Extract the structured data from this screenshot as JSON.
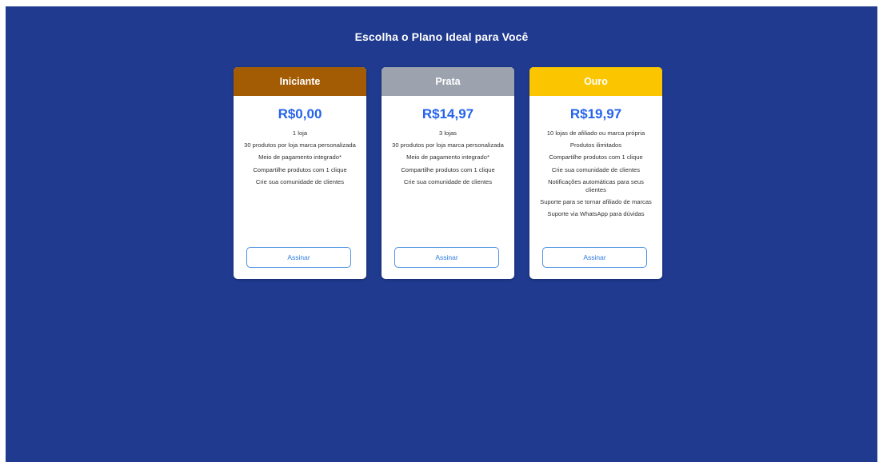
{
  "page": {
    "title": "Escolha o Plano Ideal para Você"
  },
  "colors": {
    "background": "#1f3a8f",
    "price": "#2563eb",
    "button_border": "#4a90e2"
  },
  "plans": [
    {
      "name": "Iniciante",
      "header_color": "#a45c04",
      "price": "R$0,00",
      "features": [
        "1 loja",
        "30 produtos por loja marca personalizada",
        "Meio de pagamento integrado*",
        "Compartilhe produtos com 1 clique",
        "Crie sua comunidade de clientes"
      ],
      "button_label": "Assinar"
    },
    {
      "name": "Prata",
      "header_color": "#9ca3af",
      "price": "R$14,97",
      "features": [
        "3 lojas",
        "30 produtos por loja marca personalizada",
        "Meio de pagamento integrado*",
        "Compartilhe produtos com 1 clique",
        "Crie sua comunidade de clientes"
      ],
      "button_label": "Assinar"
    },
    {
      "name": "Ouro",
      "header_color": "#fbc600",
      "price": "R$19,97",
      "features": [
        "10 lojas de afiliado ou marca própria",
        "Produtos ilimitados",
        "Compartilhe produtos com 1 clique",
        "Crie sua comunidade de clientes",
        "Notificações automáticas para seus clientes",
        "Suporte para se tornar afiliado de marcas",
        "Suporte via WhatsApp para dúvidas"
      ],
      "button_label": "Assinar"
    }
  ]
}
